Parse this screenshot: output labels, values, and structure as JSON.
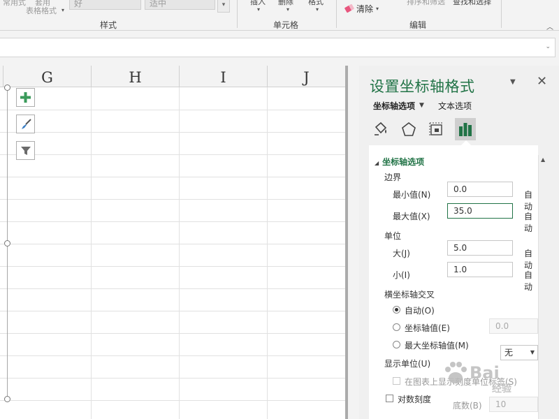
{
  "ribbon": {
    "cut_top_left": "常用式",
    "cut_table_1": "套用",
    "cut_table_2": "表格格式",
    "style_box_1": "好",
    "style_box_2": "适中",
    "cut_insert": "插入",
    "cut_delete": "删除",
    "cut_format": "格式",
    "cut_sort": "排序和筛选",
    "cut_find": "查找和选择",
    "clear_label": "清除",
    "group_styles": "样式",
    "group_cells": "单元格",
    "group_edit": "编辑"
  },
  "sheet": {
    "columns": [
      "G",
      "H",
      "I",
      "J"
    ]
  },
  "pane": {
    "title": "设置坐标轴格式",
    "tab_axis": "坐标轴选项",
    "tab_text": "文本选项",
    "icons": [
      "fill-icon",
      "effects-pentagon-icon",
      "size-properties-icon",
      "axis-options-bar-icon"
    ],
    "section": "坐标轴选项",
    "bounds_label": "边界",
    "min_label": "最小值(N)",
    "min_value": "0.0",
    "max_label": "最大值(X)",
    "max_value": "35.0",
    "auto": "自动",
    "units_label": "单位",
    "major_label": "大(J)",
    "major_value": "5.0",
    "minor_label": "小(I)",
    "minor_value": "1.0",
    "cross_label": "横坐标轴交叉",
    "cross_auto": "自动(O)",
    "cross_axis_value": "坐标轴值(E)",
    "cross_axis_value_input": "0.0",
    "cross_max": "最大坐标轴值(M)",
    "display_units_label": "显示单位(U)",
    "display_units_value": "无",
    "show_units_label": "在图表上显示刻度单位标签(S)",
    "log_label": "对数刻度",
    "base_label": "底数(B)",
    "base_value": "10"
  },
  "watermark": {
    "text": "Bai",
    "sub": "经验"
  }
}
